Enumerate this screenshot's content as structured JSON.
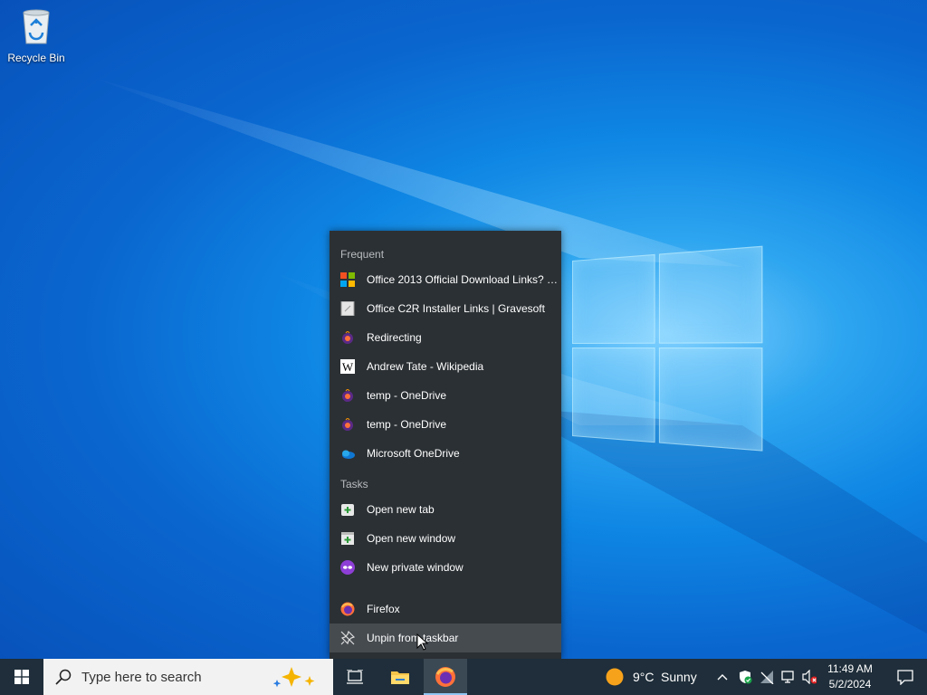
{
  "desktop": {
    "icons": [
      {
        "label": "Recycle Bin",
        "icon": "recycle-bin-icon"
      }
    ]
  },
  "jumplist": {
    "frequent_header": "Frequent",
    "frequent": [
      {
        "label": "Office 2013 Official Download Links? -...",
        "icon": "microsoft-logo-icon"
      },
      {
        "label": "Office C2R Installer Links | Gravesoft",
        "icon": "document-icon"
      },
      {
        "label": "Redirecting",
        "icon": "firefox-page-icon"
      },
      {
        "label": "Andrew Tate - Wikipedia",
        "icon": "wikipedia-icon"
      },
      {
        "label": "temp - OneDrive",
        "icon": "firefox-page-icon"
      },
      {
        "label": "temp - OneDrive",
        "icon": "firefox-page-icon"
      },
      {
        "label": "Microsoft OneDrive",
        "icon": "onedrive-cloud-icon"
      }
    ],
    "tasks_header": "Tasks",
    "tasks": [
      {
        "label": "Open new tab",
        "icon": "new-tab-icon"
      },
      {
        "label": "Open new window",
        "icon": "new-window-icon"
      },
      {
        "label": "New private window",
        "icon": "private-mask-icon"
      }
    ],
    "app": {
      "label": "Firefox",
      "icon": "firefox-icon"
    },
    "unpin": {
      "label": "Unpin from taskbar",
      "icon": "unpin-icon"
    }
  },
  "taskbar": {
    "search_placeholder": "Type here to search",
    "pinned": [
      {
        "name": "task-view",
        "icon": "task-view-icon"
      },
      {
        "name": "file-explorer",
        "icon": "folder-icon"
      },
      {
        "name": "firefox",
        "icon": "firefox-icon",
        "active": true
      }
    ],
    "weather": {
      "temp": "9°C",
      "condition": "Sunny",
      "icon": "sun-icon"
    },
    "clock": {
      "time": "11:49 AM",
      "date": "5/2/2024"
    }
  },
  "colors": {
    "taskbar": "#1f2e3a",
    "jumplist_bg": "#2b3034",
    "jumplist_hover": "#464b50",
    "accent": "#8fc6f2"
  }
}
